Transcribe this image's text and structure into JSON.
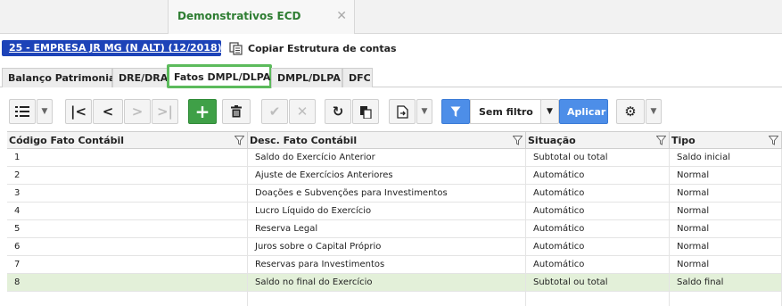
{
  "window_tab": {
    "title": "Demonstrativos ECD",
    "close_symbol": "✕"
  },
  "company": {
    "label": "25 - EMPRESA JR MG (N ALT) (12/2018)"
  },
  "copy_structure": {
    "label": "Copiar Estrutura de contas",
    "icon": "copy-structure-icon"
  },
  "module_tabs": [
    {
      "label": "Balanço Patrimonial",
      "active": false
    },
    {
      "label": "DRE/DRA",
      "active": false
    },
    {
      "label": "Fatos DMPL/DLPA",
      "active": true
    },
    {
      "label": "DMPL/DLPA",
      "active": false
    },
    {
      "label": "DFC",
      "active": false
    }
  ],
  "toolbar": {
    "filter_label": "Sem filtro",
    "apply_label": "Aplicar",
    "icons": [
      "list-icon",
      "first-icon",
      "previous-icon",
      "next-icon",
      "last-icon",
      "add-icon",
      "delete-icon",
      "confirm-icon",
      "cancel-icon",
      "refresh-icon",
      "clipboard-icon",
      "export-icon",
      "filter-icon",
      "settings-icon"
    ]
  },
  "grid": {
    "columns": [
      "Código Fato Contábil",
      "Desc. Fato Contábil",
      "Situação",
      "Tipo"
    ],
    "rows": [
      {
        "code": "1",
        "desc": "Saldo do Exercício Anterior",
        "situacao": "Subtotal ou total",
        "tipo": "Saldo inicial",
        "selected": false
      },
      {
        "code": "2",
        "desc": "Ajuste de Exercícios Anteriores",
        "situacao": "Automático",
        "tipo": "Normal",
        "selected": false
      },
      {
        "code": "3",
        "desc": "Doações e Subvenções para Investimentos",
        "situacao": "Automático",
        "tipo": "Normal",
        "selected": false
      },
      {
        "code": "4",
        "desc": "Lucro Líquido do Exercício",
        "situacao": "Automático",
        "tipo": "Normal",
        "selected": false
      },
      {
        "code": "5",
        "desc": "Reserva Legal",
        "situacao": "Automático",
        "tipo": "Normal",
        "selected": false
      },
      {
        "code": "6",
        "desc": "Juros sobre o Capital Próprio",
        "situacao": "Automático",
        "tipo": "Normal",
        "selected": false
      },
      {
        "code": "7",
        "desc": "Reservas para Investimentos",
        "situacao": "Automático",
        "tipo": "Normal",
        "selected": false
      },
      {
        "code": "8",
        "desc": "Saldo no final do Exercício",
        "situacao": "Subtotal ou total",
        "tipo": "Saldo final",
        "selected": true
      }
    ]
  },
  "colors": {
    "accent_green": "#2e7d32",
    "active_tab_border": "#5cbb5c",
    "company_blue": "#1d43b8",
    "apply_blue": "#4d8ee8",
    "selected_row": "#e3f0d9"
  }
}
